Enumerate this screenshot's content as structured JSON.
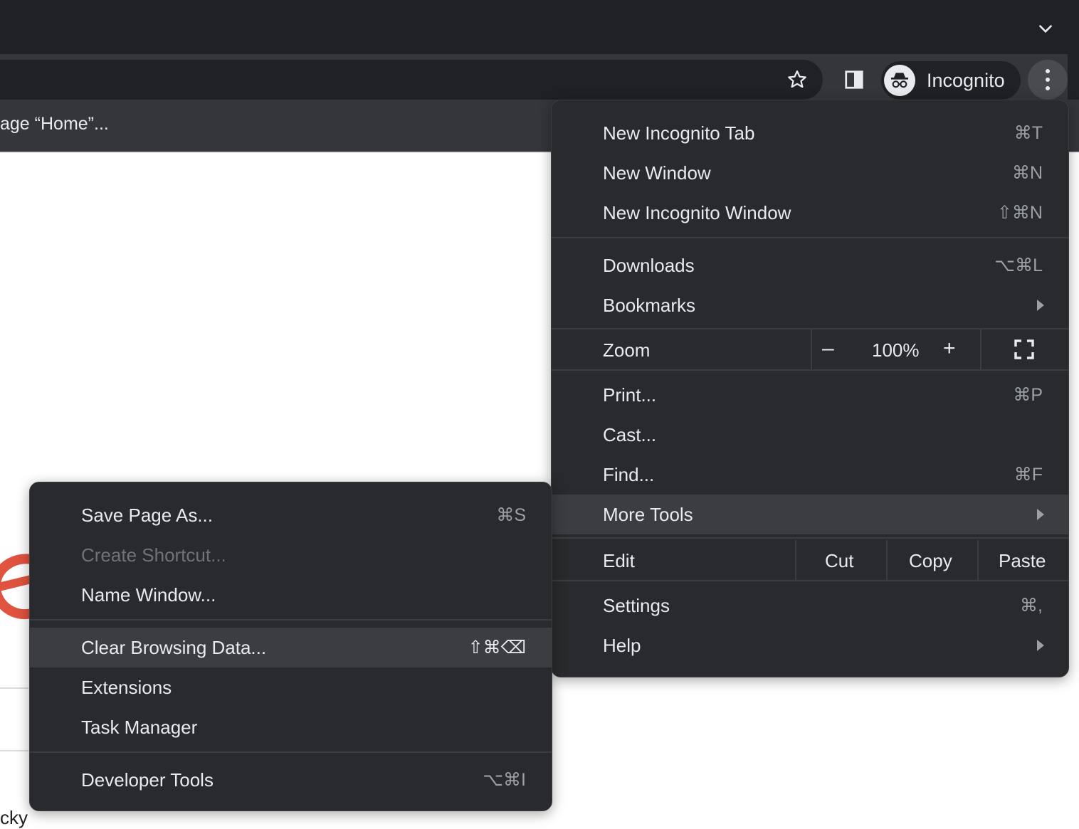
{
  "toolbar": {
    "bookmark_text": "age “Home”...",
    "profile_label": "Incognito"
  },
  "main_menu": {
    "items": [
      {
        "label": "New Incognito Tab",
        "shortcut": "⌘T"
      },
      {
        "label": "New Window",
        "shortcut": "⌘N"
      },
      {
        "label": "New Incognito Window",
        "shortcut": "⇧⌘N"
      },
      {
        "label": "Downloads",
        "shortcut": "⌥⌘L"
      },
      {
        "label": "Bookmarks"
      },
      {
        "label": "Print...",
        "shortcut": "⌘P"
      },
      {
        "label": "Cast..."
      },
      {
        "label": "Find...",
        "shortcut": "⌘F"
      },
      {
        "label": "More Tools"
      },
      {
        "label": "Settings",
        "shortcut": "⌘,"
      },
      {
        "label": "Help"
      }
    ],
    "zoom": {
      "label": "Zoom",
      "minus": "–",
      "value": "100%",
      "plus": "+"
    },
    "edit": {
      "label": "Edit",
      "cut": "Cut",
      "copy": "Copy",
      "paste": "Paste"
    }
  },
  "more_tools_menu": {
    "items": [
      {
        "label": "Save Page As...",
        "shortcut": "⌘S"
      },
      {
        "label": "Create Shortcut..."
      },
      {
        "label": "Name Window..."
      },
      {
        "label": "Clear Browsing Data...",
        "shortcut": "⇧⌘⌫"
      },
      {
        "label": "Extensions"
      },
      {
        "label": "Task Manager"
      },
      {
        "label": "Developer Tools",
        "shortcut": "⌥⌘I"
      }
    ]
  },
  "page": {
    "bottom_text": "cky"
  },
  "colors": {
    "menu_bg": "#292a2d",
    "highlight": "#3c3d41",
    "text": "#e8eaed",
    "shortcut": "#9aa0a6",
    "logo_red": "#e0533e"
  }
}
